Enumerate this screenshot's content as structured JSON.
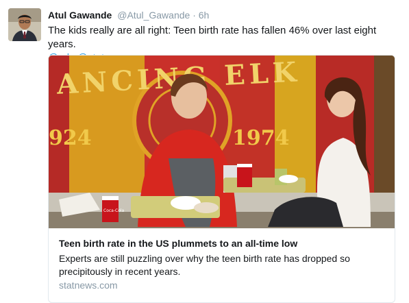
{
  "tweet": {
    "author_name": "Atul Gawande",
    "handle": "@Atul_Gawande",
    "separator": "·",
    "time": "6h",
    "text": "The kids really are all right: Teen birth rate has fallen 46% over last eight years.",
    "mention_1": "@cdc",
    "mention_2": "@statnews"
  },
  "card": {
    "banner_text_top": "ANCING ELK",
    "banner_year_left": "924",
    "banner_year_right": "1974",
    "cup_brand": "Coca-Cola",
    "title": "Teen birth rate in the US plummets to an all-time low",
    "description": "Experts are still puzzling over why the teen birth rate has dropped so precipitously in recent years.",
    "domain": "statnews.com"
  }
}
